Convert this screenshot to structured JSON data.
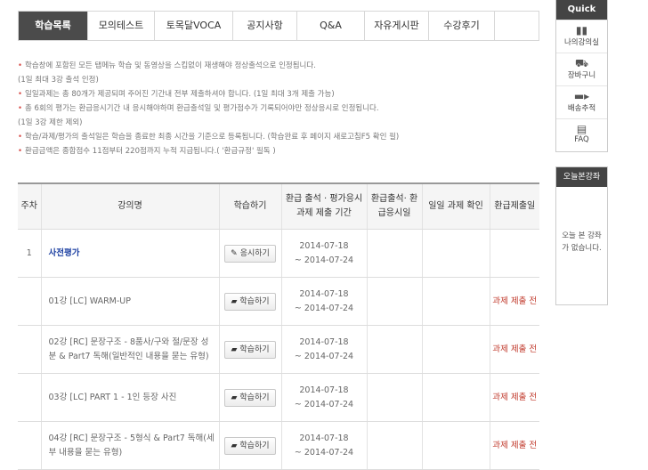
{
  "tabs": [
    {
      "label": "학습목록",
      "active": true
    },
    {
      "label": "모의테스트"
    },
    {
      "label": "토목달VOCA"
    },
    {
      "label": "공지사항"
    },
    {
      "label": "Q&A"
    },
    {
      "label": "자유게시판"
    },
    {
      "label": "수강후기"
    },
    {
      "label": ""
    }
  ],
  "notes": [
    "학습창에 포함된 모든 탭메뉴 학습 및 동영상을 스킵없이 재생해야 정상출석으로 인정됩니다.",
    "(1일 최대 3강 출석 인정)",
    "일일과제는 총 80개가 제공되며 주어진 기간내 전부 제출하셔야 합니다. (1일 최대 3개 제출 가능)",
    "총 6회의 평가는 환급응시기간 내 응시해야하며 환급출석일 및 평가점수가 기록되어야만 정상응시로 인정됩니다.",
    "(1일 3강 제한 제외)",
    "학습/과제/평가의 출석일은 학습을 종료한 최종 시간을 기준으로 등록됩니다. (학습완료 후 페이지 새로고침F5 확인 필)",
    "환급금액은 종합점수 11점부터 220점까지 누적 지급됩니다.( '환급규정' 필독 )"
  ],
  "table": {
    "headers": [
      "주차",
      "강의명",
      "학습하기",
      "환급 출석 · 평가응시 과제 제출 기간",
      "환급출석· 환급응시일",
      "일일 과제 확인",
      "환급제출일"
    ],
    "rows": [
      {
        "week": "1",
        "title": "사전평가",
        "button": "응시하기",
        "period_start": "2014-07-18",
        "period_end": "~ 2014-07-24",
        "attend": "",
        "task": "",
        "status": ""
      },
      {
        "week": "",
        "title": "01강 [LC] WARM-UP",
        "button": "학습하기",
        "period_start": "2014-07-18",
        "period_end": "~ 2014-07-24",
        "attend": "",
        "task": "",
        "status": "과제 제출 전"
      },
      {
        "week": "",
        "title": "02강 [RC] 문장구조 - 8품사/구와 절/문장 성분 & Part7 독해(일반적인 내용을 묻는 유형)",
        "button": "학습하기",
        "period_start": "2014-07-18",
        "period_end": "~ 2014-07-24",
        "attend": "",
        "task": "",
        "status": "과제 제출 전"
      },
      {
        "week": "",
        "title": "03강 [LC] PART 1 - 1인 등장 사진",
        "button": "학습하기",
        "period_start": "2014-07-18",
        "period_end": "~ 2014-07-24",
        "attend": "",
        "task": "",
        "status": "과제 제출 전"
      },
      {
        "week": "",
        "title": "04강 [RC] 문장구조 - 5형식 & Part7 독해(세부 내용을 묻는 유형)",
        "button": "학습하기",
        "period_start": "2014-07-18",
        "period_end": "~ 2014-07-24",
        "attend": "",
        "task": "",
        "status": "과제 제출 전"
      }
    ]
  },
  "quick": {
    "title": "Quick",
    "items": [
      {
        "label": "나의강의실",
        "icon": "book-icon"
      },
      {
        "label": "장바구니",
        "icon": "cart-icon"
      },
      {
        "label": "배송추적",
        "icon": "truck-icon"
      },
      {
        "label": "FAQ",
        "icon": "chat-icon"
      }
    ]
  },
  "today": {
    "title": "오늘본강좌",
    "empty_text": "오늘 본 강좌가 없습니다."
  }
}
